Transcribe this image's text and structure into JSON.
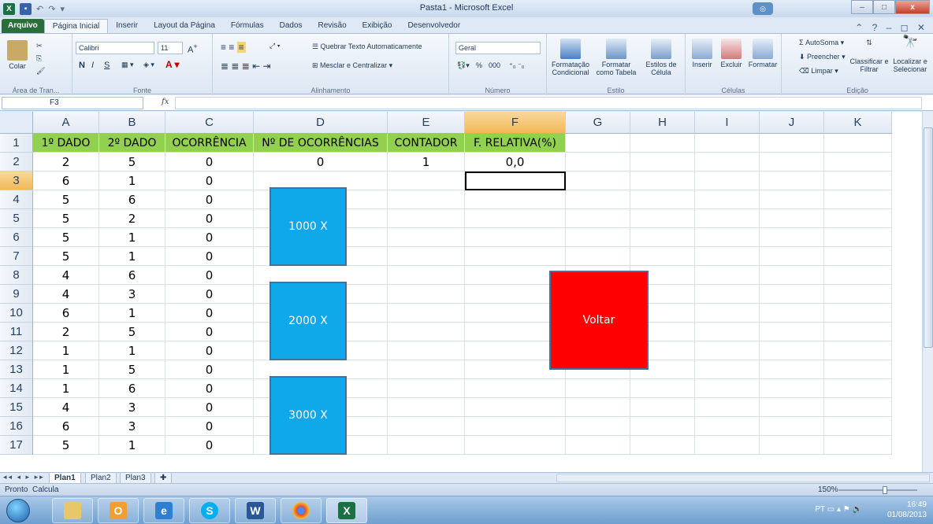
{
  "window": {
    "title": "Pasta1 - Microsoft Excel",
    "minimize": "–",
    "maximize": "□",
    "close": "x",
    "help": "◎"
  },
  "qat": {
    "undo": "↶",
    "redo": "↷",
    "more": "▾"
  },
  "ribbon_tabs": [
    "Arquivo",
    "Página Inicial",
    "Inserir",
    "Layout da Página",
    "Fórmulas",
    "Dados",
    "Revisão",
    "Exibição",
    "Desenvolvedor"
  ],
  "ribbon_tabs_right": "⌃ ? – ◻ ✕",
  "ribbon": {
    "clipboard": {
      "paste": "Colar",
      "label": "Área de Tran..."
    },
    "font": {
      "name": "Calibri",
      "size": "11",
      "bold": "N",
      "italic": "I",
      "underline": "S",
      "label": "Fonte"
    },
    "alignment": {
      "wrap": "Quebrar Texto Automaticamente",
      "merge": "Mesclar e Centralizar",
      "label": "Alinhamento"
    },
    "number": {
      "format": "Geral",
      "percent": "%",
      "thousands": "000",
      "label": "Número"
    },
    "styles": {
      "conditional": "Formatação Condicional",
      "as_table": "Formatar como Tabela",
      "cell_styles": "Estilos de Célula",
      "label": "Estilo"
    },
    "cells": {
      "insert": "Inserir",
      "delete": "Excluir",
      "format": "Formatar",
      "label": "Células"
    },
    "editing": {
      "autosum": "AutoSoma",
      "fill": "Preencher",
      "clear": "Limpar",
      "sort": "Classificar e Filtrar",
      "find": "Localizar e Selecionar",
      "label": "Edição"
    }
  },
  "formula_bar": {
    "name_box": "F3",
    "fx": "fx",
    "value": ""
  },
  "columns": [
    "A",
    "B",
    "C",
    "D",
    "E",
    "F",
    "G",
    "H",
    "I",
    "J",
    "K"
  ],
  "selected_column": "F",
  "selected_row": "3",
  "rows": [
    {
      "n": "1",
      "cells": [
        "1º DADO",
        "2º DADO",
        "OCORRÊNCIA",
        "Nº DE OCORRÊNCIAS",
        "CONTADOR",
        "F. RELATIVA(%)",
        "",
        "",
        "",
        "",
        ""
      ]
    },
    {
      "n": "2",
      "cells": [
        "2",
        "5",
        "0",
        "0",
        "1",
        "0,0",
        "",
        "",
        "",
        "",
        ""
      ]
    },
    {
      "n": "3",
      "cells": [
        "6",
        "1",
        "0",
        "",
        "",
        "",
        "",
        "",
        "",
        "",
        ""
      ]
    },
    {
      "n": "4",
      "cells": [
        "5",
        "6",
        "0",
        "",
        "",
        "",
        "",
        "",
        "",
        "",
        ""
      ]
    },
    {
      "n": "5",
      "cells": [
        "5",
        "2",
        "0",
        "",
        "",
        "",
        "",
        "",
        "",
        "",
        ""
      ]
    },
    {
      "n": "6",
      "cells": [
        "5",
        "1",
        "0",
        "",
        "",
        "",
        "",
        "",
        "",
        "",
        ""
      ]
    },
    {
      "n": "7",
      "cells": [
        "5",
        "1",
        "0",
        "",
        "",
        "",
        "",
        "",
        "",
        "",
        ""
      ]
    },
    {
      "n": "8",
      "cells": [
        "4",
        "6",
        "0",
        "",
        "",
        "",
        "",
        "",
        "",
        "",
        ""
      ]
    },
    {
      "n": "9",
      "cells": [
        "4",
        "3",
        "0",
        "",
        "",
        "",
        "",
        "",
        "",
        "",
        ""
      ]
    },
    {
      "n": "10",
      "cells": [
        "6",
        "1",
        "0",
        "",
        "",
        "",
        "",
        "",
        "",
        "",
        ""
      ]
    },
    {
      "n": "11",
      "cells": [
        "2",
        "5",
        "0",
        "",
        "",
        "",
        "",
        "",
        "",
        "",
        ""
      ]
    },
    {
      "n": "12",
      "cells": [
        "1",
        "1",
        "0",
        "",
        "",
        "",
        "",
        "",
        "",
        "",
        ""
      ]
    },
    {
      "n": "13",
      "cells": [
        "1",
        "5",
        "0",
        "",
        "",
        "",
        "",
        "",
        "",
        "",
        ""
      ]
    },
    {
      "n": "14",
      "cells": [
        "1",
        "6",
        "0",
        "",
        "",
        "",
        "",
        "",
        "",
        "",
        ""
      ]
    },
    {
      "n": "15",
      "cells": [
        "4",
        "3",
        "0",
        "",
        "",
        "",
        "",
        "",
        "",
        "",
        ""
      ]
    },
    {
      "n": "16",
      "cells": [
        "6",
        "3",
        "0",
        "",
        "",
        "",
        "",
        "",
        "",
        "",
        ""
      ]
    },
    {
      "n": "17",
      "cells": [
        "5",
        "1",
        "0",
        "",
        "",
        "",
        "",
        "",
        "",
        "",
        ""
      ]
    }
  ],
  "shapes": {
    "btn1000": "1000 X",
    "btn2000": "2000 X",
    "btn3000": "3000 X",
    "voltar": "Voltar"
  },
  "sheets": [
    "Plan1",
    "Plan2",
    "Plan3"
  ],
  "active_sheet": "Plan1",
  "status": {
    "mode": "Pronto",
    "calc": "Calcula",
    "zoom": "150%"
  },
  "taskbar": {
    "apps": [
      "Explorer",
      "Outlook",
      "Internet Explorer",
      "Skype",
      "Word",
      "Chrome",
      "Excel"
    ],
    "tray_lang": "PT",
    "time": "16:49",
    "date": "01/08/2013"
  },
  "colors": {
    "header_fill": "#92d050",
    "shape_blue": "#0fa8e8",
    "shape_red": "#ff0000",
    "selection": "#f2b857"
  }
}
